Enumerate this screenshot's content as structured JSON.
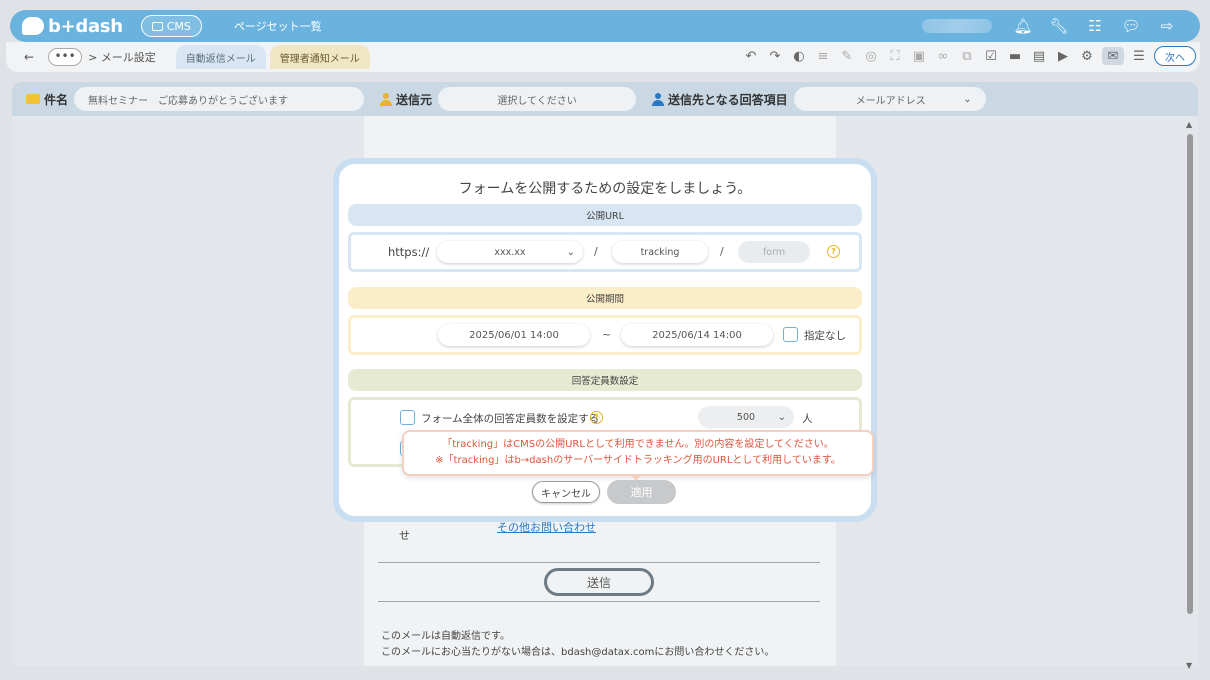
{
  "header": {
    "logo_text": "b+dash",
    "cms_label": "CMS",
    "page_set_label": "ページセット一覧",
    "icons": [
      "bell-icon",
      "wrench-icon",
      "grid-icon",
      "chat-icon",
      "logout-icon"
    ]
  },
  "toolbar": {
    "back": "←",
    "more": "•••",
    "breadcrumb": "> メール設定",
    "tabs": [
      "自動返信メール",
      "管理者通知メール"
    ],
    "next_label": "次へ"
  },
  "fields": {
    "subject_label": "件名",
    "subject_value": "無料セミナー　ご応募ありがとうございます",
    "sender_label": "送信元",
    "sender_placeholder": "選択してください",
    "recipient_label": "送信先となる回答項目",
    "recipient_value": "メールアドレス"
  },
  "paper": {
    "fragment": "せ",
    "link_text": "その他お問い合わせ",
    "send_button": "送信",
    "footer_line1": "このメールは自動返信です。",
    "footer_line2": "このメールにお心当たりがない場合は、bdash@datax.comにお問い合わせください。"
  },
  "modal": {
    "title": "フォームを公開するための設定をしましょう。",
    "url_section": "公開URL",
    "url_prefix": "https://",
    "domain_select": "xxx.xx",
    "slash": "/",
    "path1": "tracking",
    "path2_placeholder": "form",
    "period_section": "公開期間",
    "start_date": "2025/06/01 14:00",
    "tilde": "~",
    "end_date": "2025/06/14 14:00",
    "no_period_label": "指定なし",
    "capacity_section": "回答定員数設定",
    "capacity_checkbox_label": "フォーム全体の回答定員数を設定する",
    "capacity_value": "500",
    "capacity_unit": "人",
    "cancel_label": "キャンセル",
    "apply_label": "適用"
  },
  "tooltip": {
    "line1": "「tracking」はCMSの公開URLとして利用できません。別の内容を設定してください。",
    "line2": "※「tracking」はb→dashのサーバーサイドトラッキング用のURLとして利用しています。"
  },
  "colors": {
    "header_bg": "#6ab3df",
    "error_text": "#e0533a",
    "accent_blue": "#2a78c2"
  }
}
